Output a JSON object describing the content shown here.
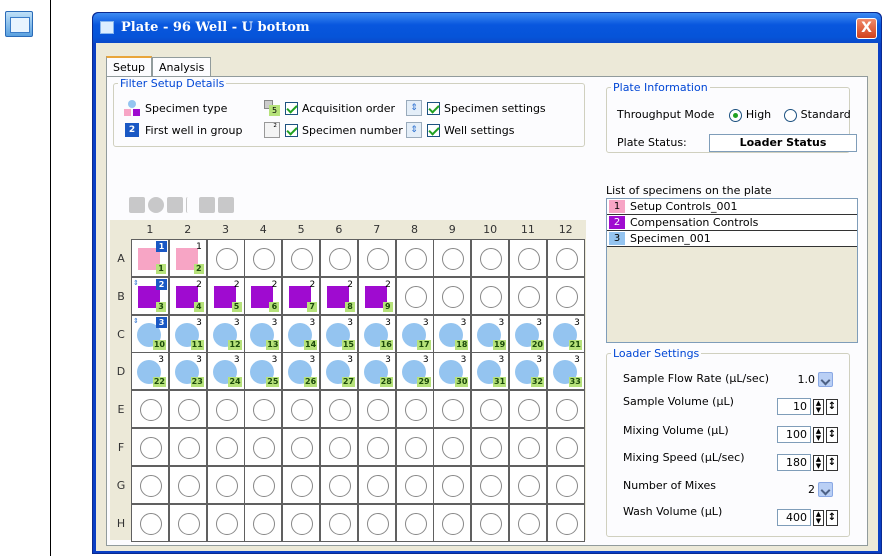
{
  "window": {
    "title": "Plate - 96 Well - U bottom",
    "close_label": "X"
  },
  "tabs": [
    {
      "label": "Setup",
      "active": true
    },
    {
      "label": "Analysis",
      "active": false
    }
  ],
  "filter": {
    "legend": "Filter Setup Details",
    "items": [
      {
        "label": "Specimen type",
        "checkbox": false,
        "checked": false
      },
      {
        "label": "Acquisition order",
        "checkbox": true,
        "checked": true
      },
      {
        "label": "Specimen settings",
        "checkbox": true,
        "checked": true
      },
      {
        "label": "First well in group",
        "checkbox": false,
        "checked": false
      },
      {
        "label": "Specimen number",
        "checkbox": true,
        "checked": true
      },
      {
        "label": "Well settings",
        "checkbox": true,
        "checked": true
      }
    ]
  },
  "plate": {
    "columns": [
      "1",
      "2",
      "3",
      "4",
      "5",
      "6",
      "7",
      "8",
      "9",
      "10",
      "11",
      "12"
    ],
    "rows": [
      "A",
      "B",
      "C",
      "D",
      "E",
      "F",
      "G",
      "H"
    ],
    "specimen_colors": {
      "1": "#f7a5c5",
      "2": "#9f0bd0",
      "3": "#94c4f0"
    },
    "wells": [
      {
        "row": 0,
        "col": 0,
        "specimen": 1,
        "order": "1",
        "first": "1"
      },
      {
        "row": 0,
        "col": 1,
        "specimen": 1,
        "order": "2"
      },
      {
        "row": 1,
        "col": 0,
        "specimen": 2,
        "order": "3",
        "first": "2"
      },
      {
        "row": 1,
        "col": 1,
        "specimen": 2,
        "order": "4"
      },
      {
        "row": 1,
        "col": 2,
        "specimen": 2,
        "order": "5"
      },
      {
        "row": 1,
        "col": 3,
        "specimen": 2,
        "order": "6"
      },
      {
        "row": 1,
        "col": 4,
        "specimen": 2,
        "order": "7"
      },
      {
        "row": 1,
        "col": 5,
        "specimen": 2,
        "order": "8"
      },
      {
        "row": 1,
        "col": 6,
        "specimen": 2,
        "order": "9"
      },
      {
        "row": 2,
        "col": 0,
        "specimen": 3,
        "order": "10",
        "first": "3"
      },
      {
        "row": 2,
        "col": 1,
        "specimen": 3,
        "order": "11"
      },
      {
        "row": 2,
        "col": 2,
        "specimen": 3,
        "order": "12"
      },
      {
        "row": 2,
        "col": 3,
        "specimen": 3,
        "order": "13"
      },
      {
        "row": 2,
        "col": 4,
        "specimen": 3,
        "order": "14"
      },
      {
        "row": 2,
        "col": 5,
        "specimen": 3,
        "order": "15"
      },
      {
        "row": 2,
        "col": 6,
        "specimen": 3,
        "order": "16"
      },
      {
        "row": 2,
        "col": 7,
        "specimen": 3,
        "order": "17"
      },
      {
        "row": 2,
        "col": 8,
        "specimen": 3,
        "order": "18"
      },
      {
        "row": 2,
        "col": 9,
        "specimen": 3,
        "order": "19"
      },
      {
        "row": 2,
        "col": 10,
        "specimen": 3,
        "order": "20"
      },
      {
        "row": 2,
        "col": 11,
        "specimen": 3,
        "order": "21"
      },
      {
        "row": 3,
        "col": 0,
        "specimen": 3,
        "order": "22"
      },
      {
        "row": 3,
        "col": 1,
        "specimen": 3,
        "order": "23"
      },
      {
        "row": 3,
        "col": 2,
        "specimen": 3,
        "order": "24"
      },
      {
        "row": 3,
        "col": 3,
        "specimen": 3,
        "order": "25"
      },
      {
        "row": 3,
        "col": 4,
        "specimen": 3,
        "order": "26"
      },
      {
        "row": 3,
        "col": 5,
        "specimen": 3,
        "order": "27"
      },
      {
        "row": 3,
        "col": 6,
        "specimen": 3,
        "order": "28"
      },
      {
        "row": 3,
        "col": 7,
        "specimen": 3,
        "order": "29"
      },
      {
        "row": 3,
        "col": 8,
        "specimen": 3,
        "order": "30"
      },
      {
        "row": 3,
        "col": 9,
        "specimen": 3,
        "order": "31"
      },
      {
        "row": 3,
        "col": 10,
        "specimen": 3,
        "order": "32"
      },
      {
        "row": 3,
        "col": 11,
        "specimen": 3,
        "order": "33"
      }
    ]
  },
  "plate_info": {
    "legend": "Plate Information",
    "throughput_label": "Throughput Mode",
    "mode_high": "High",
    "mode_standard": "Standard",
    "selected_mode": "High",
    "status_label": "Plate Status:",
    "status_value": "Loader Status"
  },
  "specimens": {
    "title": "List of specimens on the plate",
    "items": [
      {
        "num": "1",
        "name": "Setup Controls_001"
      },
      {
        "num": "2",
        "name": "Compensation Controls"
      },
      {
        "num": "3",
        "name": "Specimen_001"
      }
    ]
  },
  "loader": {
    "legend": "Loader Settings",
    "flow_rate": {
      "label": "Sample Flow Rate (µL/sec)",
      "value": "1.0"
    },
    "sample_volume": {
      "label": "Sample Volume (µL)",
      "value": "10"
    },
    "mixing_volume": {
      "label": "Mixing Volume (µL)",
      "value": "100"
    },
    "mixing_speed": {
      "label": "Mixing Speed (µL/sec)",
      "value": "180"
    },
    "num_mixes": {
      "label": "Number of Mixes",
      "value": "2"
    },
    "wash_volume": {
      "label": "Wash Volume (µL)",
      "value": "400"
    }
  }
}
